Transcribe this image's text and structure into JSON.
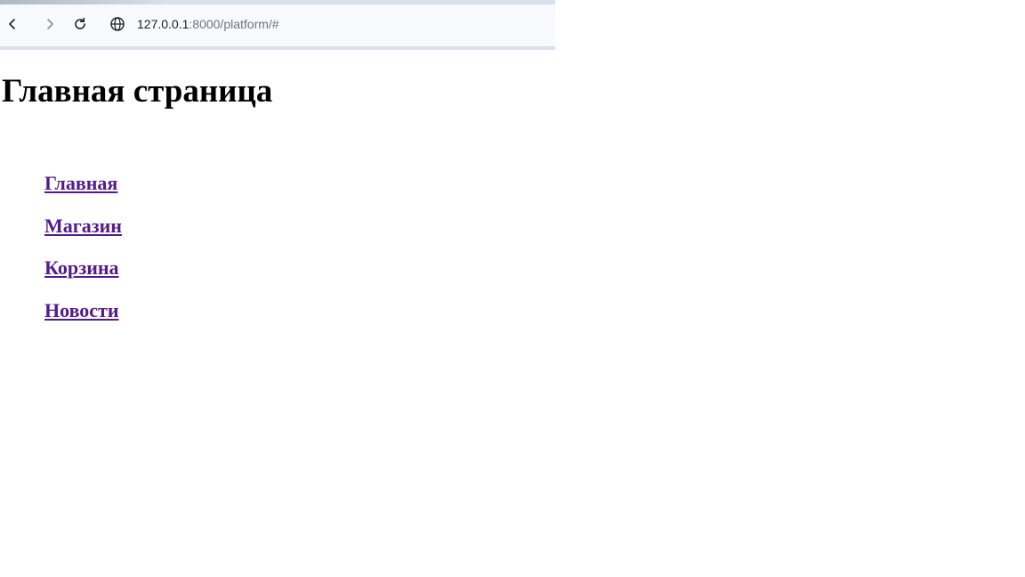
{
  "browser": {
    "url_host": "127.0.0.1",
    "url_rest": ":8000/platform/#",
    "icons": {
      "back": "arrow-left-icon",
      "forward": "arrow-right-icon",
      "reload": "reload-icon",
      "site_info": "globe-icon"
    }
  },
  "page": {
    "title": "Главная страница",
    "nav": [
      {
        "label": "Главная"
      },
      {
        "label": "Магазин"
      },
      {
        "label": "Корзина"
      },
      {
        "label": "Новости"
      }
    ]
  },
  "colors": {
    "visited_link": "#551a8b",
    "text": "#000000",
    "chrome_bg": "#f7f9fc"
  }
}
